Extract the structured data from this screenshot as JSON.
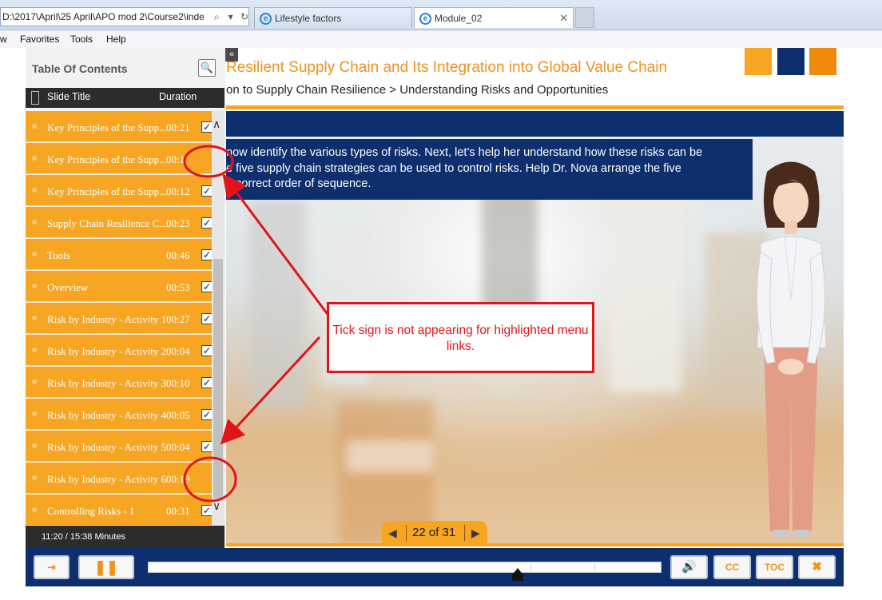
{
  "browser": {
    "address": "D:\\2017\\April\\25 April\\APO mod 2\\Course2\\inde",
    "tabs": [
      {
        "label": "Lifestyle factors",
        "active": false
      },
      {
        "label": "Module_02",
        "active": true
      }
    ],
    "menu": [
      "w",
      "Favorites",
      "Tools",
      "Help"
    ]
  },
  "course": {
    "title": "Resilient Supply Chain and Its Integration into Global Value Chain",
    "breadcrumb": "on to Supply Chain Resilience > Understanding Risks and Opportunities",
    "brand_colors": [
      "#f6a623",
      "#0d2f6e",
      "#f08a0c"
    ],
    "instruction_lines": [
      "now identify the various types of risks. Next, let’s help her understand how these risks can be",
      "e five supply chain strategies can be used to control risks. Help Dr. Nova arrange the five",
      "e correct order of sequence."
    ]
  },
  "toc": {
    "heading": "Table Of Contents",
    "col_title": "Slide Title",
    "col_duration": "Duration",
    "rows": [
      {
        "title": "Key Principles of the Supp...",
        "duration": "00:21",
        "checked": true
      },
      {
        "title": "Key Principles of the Supp...",
        "duration": "00:1",
        "checked": false
      },
      {
        "title": "Key Principles of the Supp...",
        "duration": "00:12",
        "checked": true
      },
      {
        "title": "Supply Chain Resilience C...",
        "duration": "00:23",
        "checked": true
      },
      {
        "title": "Tools",
        "duration": "00:46",
        "checked": true
      },
      {
        "title": "Overview",
        "duration": "00:53",
        "checked": true
      },
      {
        "title": "Risk by Industry - Activity 1",
        "duration": "00:27",
        "checked": true
      },
      {
        "title": "Risk by Industry - Activity 2",
        "duration": "00:04",
        "checked": true
      },
      {
        "title": "Risk by Industry - Activity 3",
        "duration": "00:10",
        "checked": true
      },
      {
        "title": "Risk by Industry - Activity 4",
        "duration": "00:05",
        "checked": true
      },
      {
        "title": "Risk by Industry - Activity 5",
        "duration": "00:04",
        "checked": true
      },
      {
        "title": "Risk by Industry - Activity 6",
        "duration": "00:19",
        "checked": false
      },
      {
        "title": "Controlling Risks - 1",
        "duration": "00:31",
        "checked": true
      }
    ],
    "footer": "11:20 / 15:38 Minutes"
  },
  "pager": {
    "label": "22 of 31"
  },
  "controls": {
    "exit_icon": "exit-icon",
    "pause_icon": "pause-icon",
    "volume_icon": "speaker-icon",
    "cc_label": "CC",
    "toc_label": "TOC",
    "close_icon": "close-icon",
    "progress": 0.72
  },
  "annotation": {
    "text": "Tick sign is not appearing for highlighted menu links.",
    "color": "#e2141b"
  }
}
